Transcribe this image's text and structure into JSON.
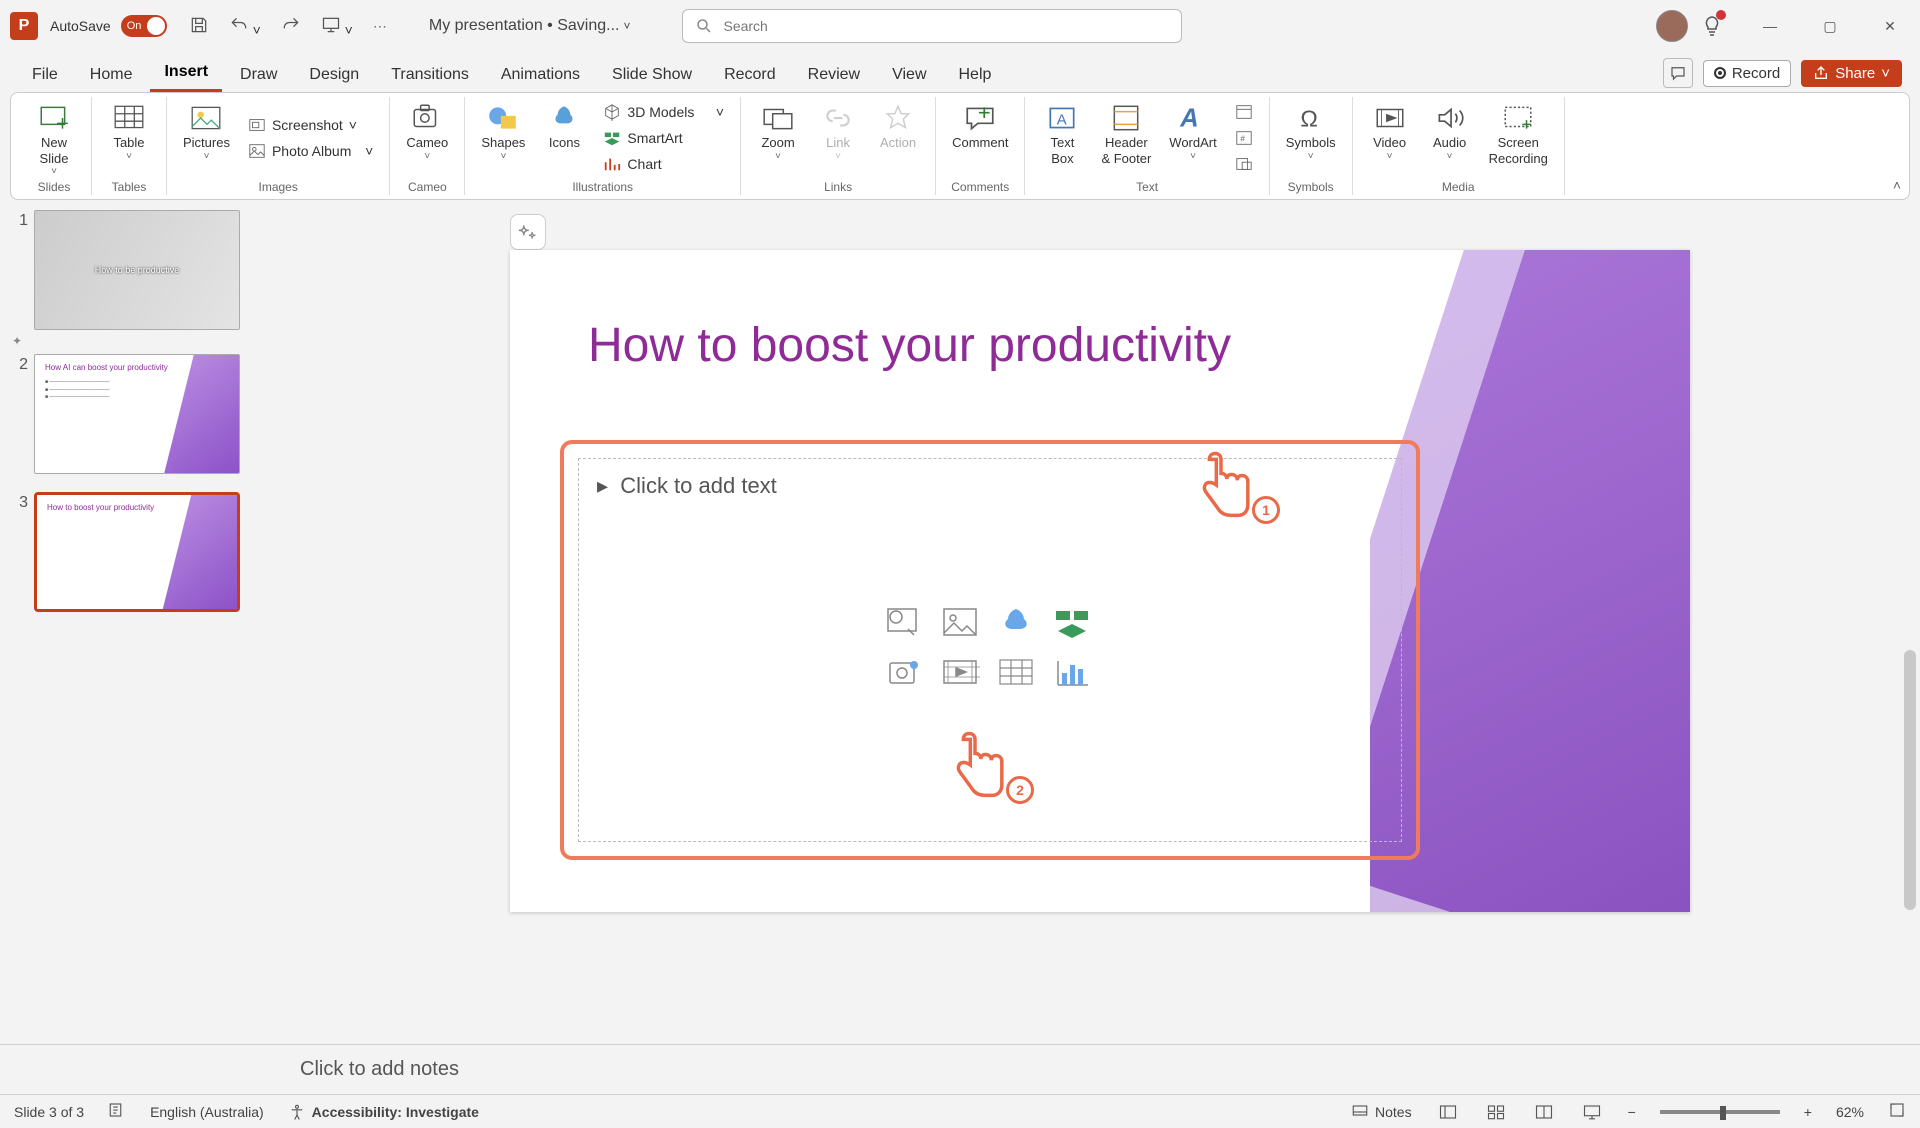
{
  "titlebar": {
    "autosave_label": "AutoSave",
    "autosave_state": "On",
    "doc_title": "My presentation • Saving...",
    "search_placeholder": "Search"
  },
  "tabs": [
    "File",
    "Home",
    "Insert",
    "Draw",
    "Design",
    "Transitions",
    "Animations",
    "Slide Show",
    "Record",
    "Review",
    "View",
    "Help"
  ],
  "active_tab": "Insert",
  "ribbon_rhs": {
    "record": "Record",
    "share": "Share"
  },
  "ribbon": {
    "groups": {
      "slides": {
        "label": "Slides",
        "new_slide": "New\nSlide"
      },
      "tables": {
        "label": "Tables",
        "table": "Table"
      },
      "images": {
        "label": "Images",
        "pictures": "Pictures",
        "screenshot": "Screenshot",
        "photo_album": "Photo Album"
      },
      "cameo": {
        "label": "Cameo",
        "cameo": "Cameo"
      },
      "illustrations": {
        "label": "Illustrations",
        "shapes": "Shapes",
        "icons": "Icons",
        "models": "3D Models",
        "smartart": "SmartArt",
        "chart": "Chart"
      },
      "links": {
        "label": "Links",
        "zoom": "Zoom",
        "link": "Link",
        "action": "Action"
      },
      "comments": {
        "label": "Comments",
        "comment": "Comment"
      },
      "text": {
        "label": "Text",
        "text_box": "Text\nBox",
        "header_footer": "Header\n& Footer",
        "wordart": "WordArt"
      },
      "symbols": {
        "label": "Symbols",
        "symbols": "Symbols"
      },
      "media": {
        "label": "Media",
        "video": "Video",
        "audio": "Audio",
        "screen_rec": "Screen\nRecording"
      }
    }
  },
  "thumbnails": [
    {
      "num": "1",
      "title": "How to be productive"
    },
    {
      "num": "2",
      "title": "How AI can boost your productivity"
    },
    {
      "num": "3",
      "title": "How to boost your productivity"
    }
  ],
  "slide": {
    "title": "How to boost your productivity",
    "placeholder": "Click to add text"
  },
  "annotations": {
    "one": "1",
    "two": "2"
  },
  "notes": {
    "placeholder": "Click to add notes"
  },
  "status": {
    "slide_count": "Slide 3 of 3",
    "language": "English (Australia)",
    "accessibility": "Accessibility: Investigate",
    "notes_btn": "Notes",
    "zoom": "62%"
  }
}
